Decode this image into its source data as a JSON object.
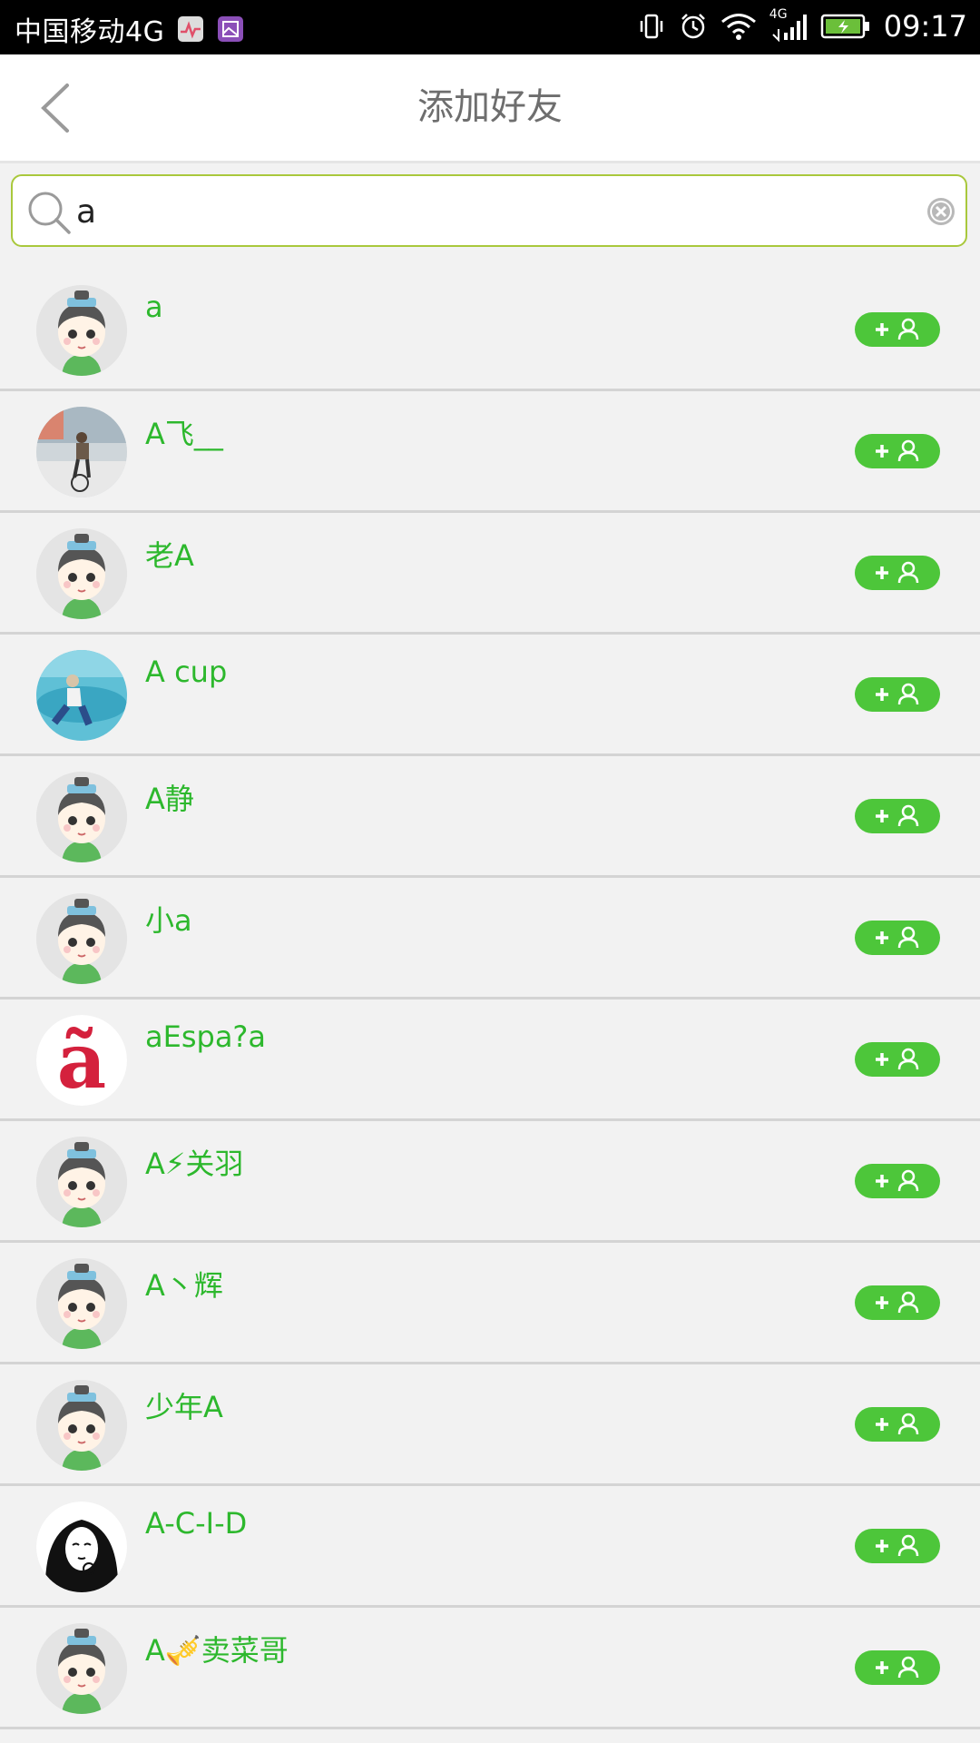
{
  "status_bar": {
    "carrier": "中国移动4G",
    "network": "4G",
    "time": "09:17"
  },
  "header": {
    "title": "添加好友"
  },
  "search": {
    "value": "a"
  },
  "results": [
    {
      "name": "a",
      "avatar": "default-cartoon"
    },
    {
      "name": "A飞__",
      "avatar": "photo-cyclist"
    },
    {
      "name": "老A",
      "avatar": "default-cartoon"
    },
    {
      "name": "A cup",
      "avatar": "photo-sea"
    },
    {
      "name": "A静",
      "avatar": "default-cartoon"
    },
    {
      "name": "小a",
      "avatar": "default-cartoon"
    },
    {
      "name": "aEspa?a",
      "avatar": "letter-a-tilde"
    },
    {
      "name": "A⚡关羽",
      "avatar": "default-cartoon"
    },
    {
      "name": "A丶辉",
      "avatar": "default-cartoon"
    },
    {
      "name": "少年A",
      "avatar": "default-cartoon"
    },
    {
      "name": "A-C-I-D",
      "avatar": "sketch-girl"
    },
    {
      "name": "A🎺卖菜哥",
      "avatar": "default-cartoon"
    }
  ],
  "colors": {
    "accent_green": "#4dc63a",
    "name_green": "#2db82d",
    "search_border": "#a9c83c"
  }
}
